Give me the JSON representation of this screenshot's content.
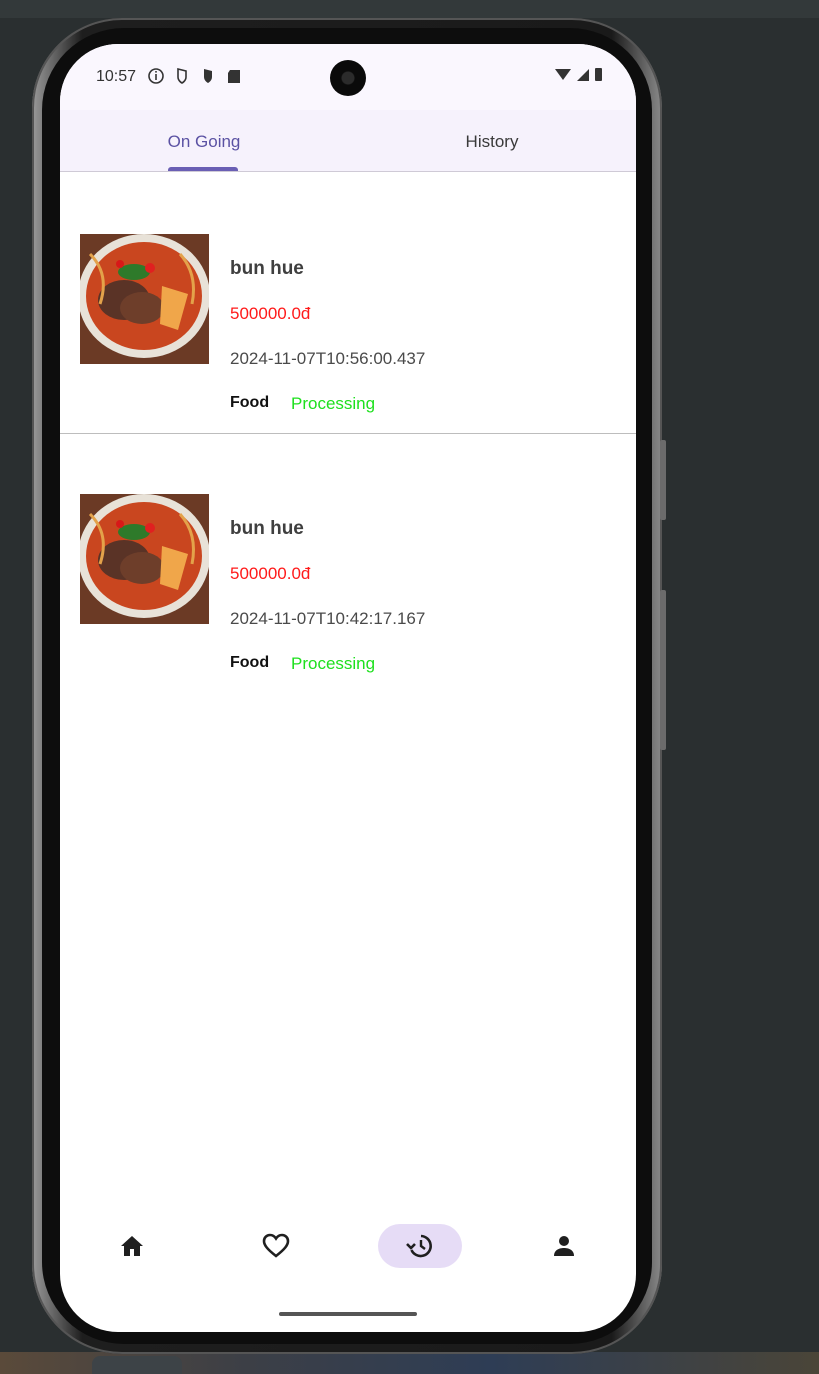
{
  "status_bar": {
    "time": "10:57",
    "icons": [
      "info-icon",
      "shield-icon",
      "shield-filled-icon",
      "sd-card-icon"
    ],
    "right_icons": [
      "wifi-icon",
      "signal-icon",
      "battery-icon"
    ]
  },
  "tabs": [
    {
      "label": "On Going",
      "active": true
    },
    {
      "label": "History",
      "active": false
    }
  ],
  "orders": [
    {
      "name": "bun hue",
      "price": "500000.0đ",
      "datetime": "2024-11-07T10:56:00.437",
      "category": "Food",
      "status": "Processing"
    },
    {
      "name": "bun hue",
      "price": "500000.0đ",
      "datetime": "2024-11-07T10:42:17.167",
      "category": "Food",
      "status": "Processing"
    }
  ],
  "bottom_nav": {
    "items": [
      "home-icon",
      "favorite-icon",
      "history-icon",
      "profile-icon"
    ],
    "selected": "history-icon"
  },
  "colors": {
    "accent": "#6a5fb4",
    "price": "#ff1a1a",
    "status_processing": "#1ee01e",
    "nav_selected_bg": "#e6dcf6"
  }
}
